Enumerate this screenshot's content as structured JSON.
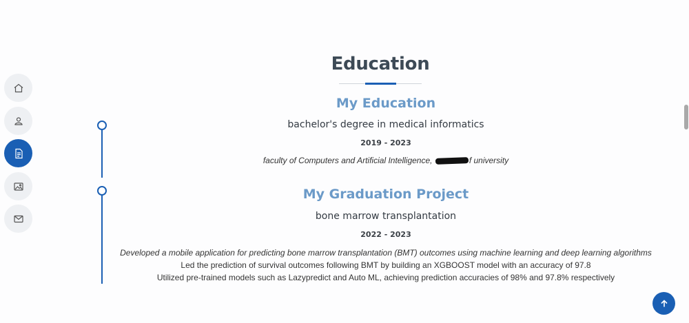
{
  "nav": {
    "items": [
      {
        "icon": "home-icon",
        "active": false
      },
      {
        "icon": "user-icon",
        "active": false
      },
      {
        "icon": "resume-icon",
        "active": true
      },
      {
        "icon": "images-icon",
        "active": false
      },
      {
        "icon": "envelope-icon",
        "active": false
      }
    ]
  },
  "section": {
    "title": "Education"
  },
  "entries": [
    {
      "title": "My Education",
      "subtitle": "bachelor's degree in medical informatics",
      "dates": "2019 - 2023",
      "detail_before": "faculty of Computers and Artificial Intelligence, ",
      "detail_after": "f university"
    },
    {
      "title": "My Graduation Project",
      "subtitle": "bone marrow transplantation",
      "dates": "2022 - 2023",
      "lines": [
        "Developed a mobile application for predicting bone marrow transplantation (BMT) outcomes using machine learning and deep learning algorithms",
        "Led the prediction of survival outcomes following BMT by building an XGBOOST model with an accuracy of 97.8",
        "Utilized pre-trained models such as Lazypredict and Auto ML, achieving prediction accuracies of 98% and 97.8% respectively"
      ]
    }
  ],
  "colors": {
    "accent": "#1a5fb4",
    "title": "#3d4a56",
    "entry_title": "#6b9ac8"
  },
  "back_to_top": {
    "icon": "arrow-up-icon"
  }
}
